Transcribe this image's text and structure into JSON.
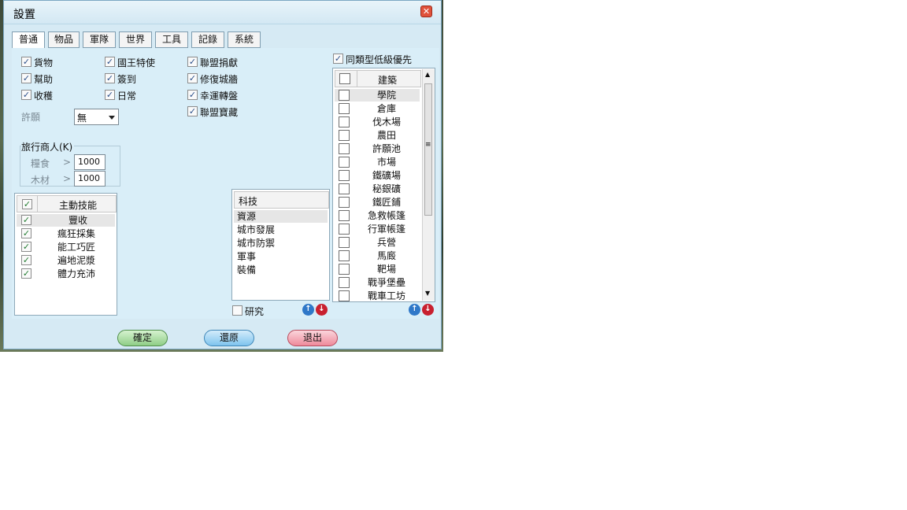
{
  "window": {
    "title": "設置",
    "close_symbol": "✕"
  },
  "tabs": [
    "普通",
    "物品",
    "軍隊",
    "世界",
    "工具",
    "記錄",
    "系統"
  ],
  "checkboxes": [
    {
      "label": "貨物",
      "checked": true
    },
    {
      "label": "幫助",
      "checked": true
    },
    {
      "label": "收穫",
      "checked": true
    },
    {
      "label": "國王特使",
      "checked": true
    },
    {
      "label": "簽到",
      "checked": true
    },
    {
      "label": "日常",
      "checked": true
    },
    {
      "label": "聯盟捐獻",
      "checked": true
    },
    {
      "label": "修復城牆",
      "checked": true
    },
    {
      "label": "幸運轉盤",
      "checked": true
    },
    {
      "label": "聯盟寶藏",
      "checked": true
    }
  ],
  "wish": {
    "label": "許願",
    "value": "無"
  },
  "merchant": {
    "title": "旅行商人(K)",
    "food_label": "糧食",
    "food_value": "1000",
    "wood_label": "木材",
    "wood_value": "1000",
    "gt": ">"
  },
  "skills": {
    "header": "主動技能",
    "items": [
      "豐收",
      "瘋狂採集",
      "能工巧匠",
      "遍地泥漿",
      "體力充沛"
    ]
  },
  "tech": {
    "header": "科技",
    "items": [
      "資源",
      "城市發展",
      "城市防禦",
      "軍事",
      "裝備"
    ],
    "research_label": "研究"
  },
  "buildings": {
    "priority_label": "同類型低級優先",
    "header": "建築",
    "items": [
      "學院",
      "倉庫",
      "伐木場",
      "農田",
      "許願池",
      "市場",
      "鐵礦場",
      "秘銀礦",
      "鐵匠鋪",
      "急救帳篷",
      "行軍帳篷",
      "兵營",
      "馬廄",
      "靶場",
      "戰爭堡壘",
      "戰車工坊"
    ]
  },
  "icons": {
    "check": "✓",
    "up": "↑",
    "down": "↓",
    "scroll_up": "▲",
    "scroll_down": "▼",
    "grip": "≡"
  },
  "buttons": {
    "confirm": "確定",
    "restore": "還原",
    "exit": "退出"
  }
}
